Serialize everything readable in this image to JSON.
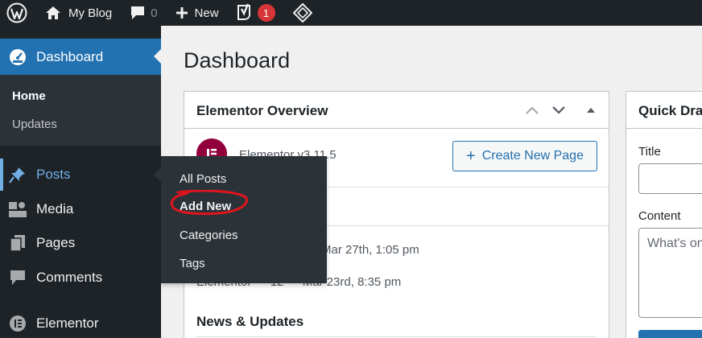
{
  "adminbar": {
    "site_name": "My Blog",
    "comments_count": "0",
    "new_label": "New",
    "yoast_badge": "1"
  },
  "sidebar": {
    "dashboard_label": "Dashboard",
    "submenu": [
      "Home",
      "Updates"
    ],
    "items": [
      "Posts",
      "Media",
      "Pages",
      "Comments",
      "Elementor"
    ]
  },
  "flyout": {
    "items": [
      "All Posts",
      "Add New",
      "Categories",
      "Tags"
    ],
    "highlighted": "Add New"
  },
  "main": {
    "title": "Dashboard",
    "elementor_overview": {
      "title": "Elementor Overview",
      "version": "Elementor v3.11.5",
      "create_button": "Create New Page",
      "recent_1": "Mar 27th, 1:05 pm",
      "recent_2": "Elementor — 12 — Mar 23rd, 8:35 pm",
      "news_title": "News & Updates"
    },
    "quick_draft": {
      "title": "Quick Draft",
      "title_label": "Title",
      "content_label": "Content",
      "content_placeholder": "What's on your mind?"
    }
  },
  "colors": {
    "admin_dark": "#1d2327",
    "accent_blue": "#2271b1",
    "hover_blue": "#72aee6",
    "badge_red": "#d63638",
    "elementor_magenta": "#92003b",
    "annotation_red": "#e0141e"
  }
}
